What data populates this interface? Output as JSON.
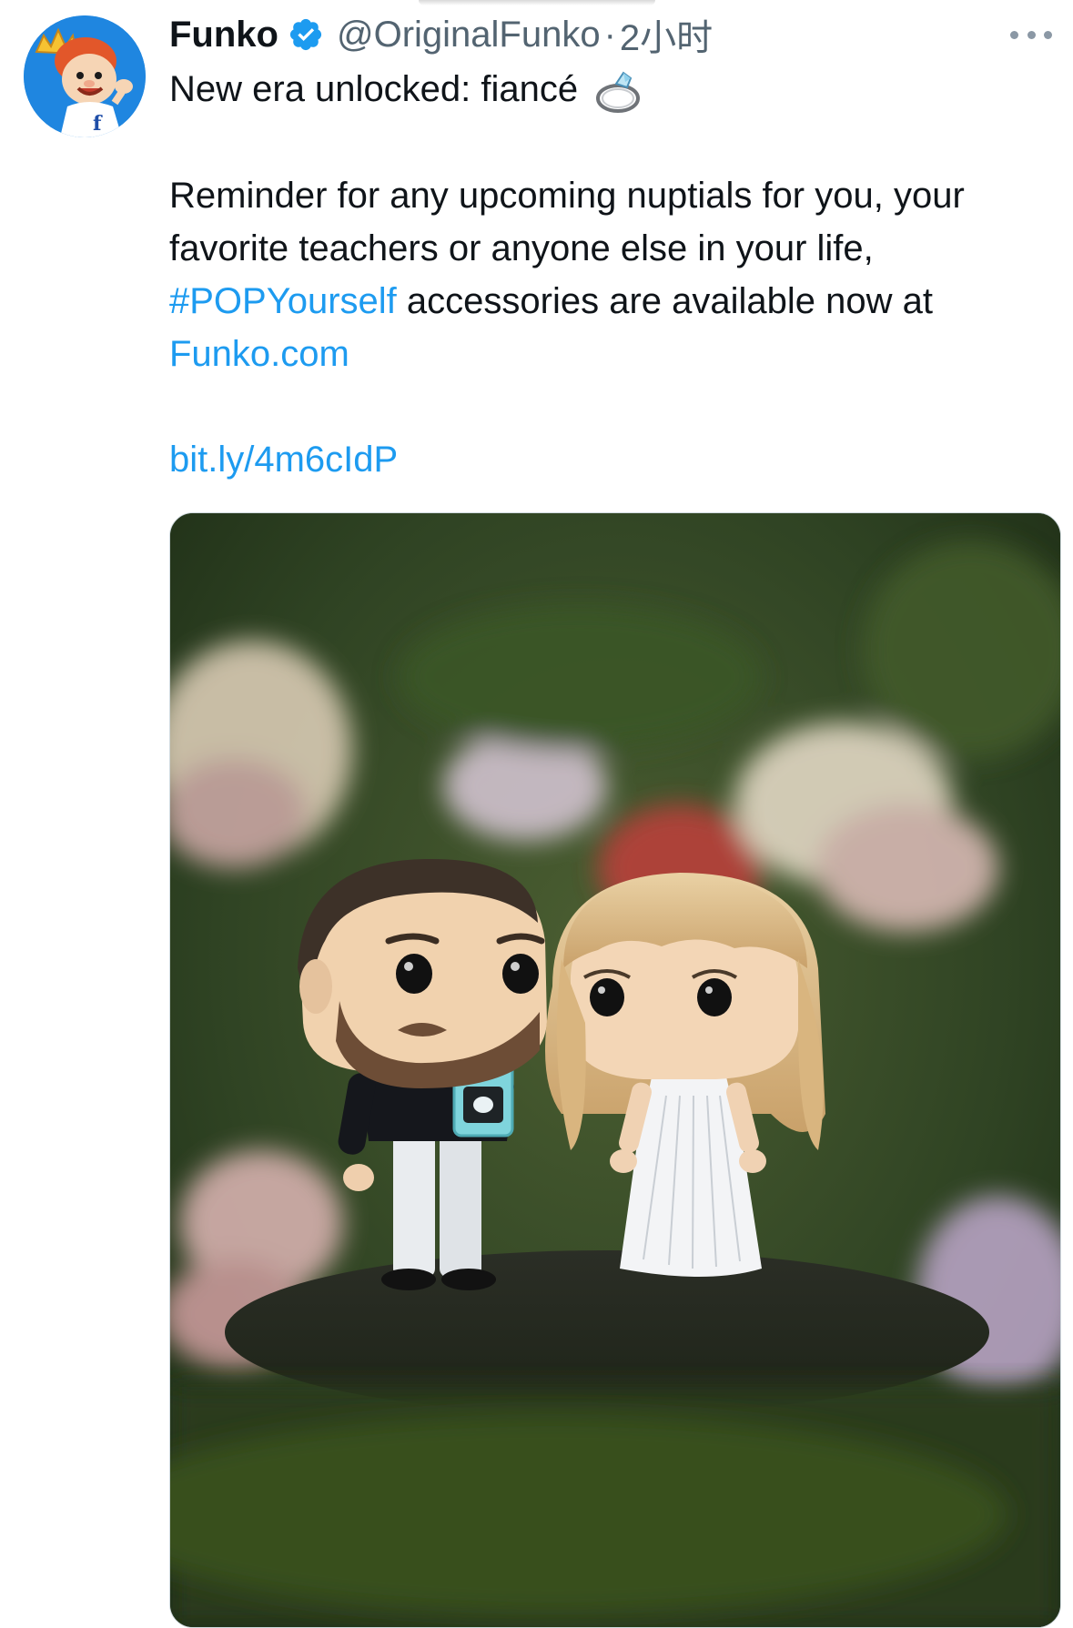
{
  "tweet": {
    "display_name": "Funko",
    "handle": "@OriginalFunko",
    "separator": "·",
    "time": "2小时",
    "line1": "New era unlocked: fiancé",
    "para_start": "Reminder for any upcoming nuptials for you, your favorite teachers or anyone else in your life, ",
    "hashtag": "#POPYourself",
    "para_mid": " accessories are available now at ",
    "site_link": "Funko.com",
    "short_url": "bit.ly/4m6cIdP"
  },
  "icons": {
    "avatar": "funko-mascot-avatar",
    "verified": "verified-badge-icon",
    "ring": "ring-emoji-icon",
    "more": "more-options-icon"
  },
  "colors": {
    "link": "#1d9bf0",
    "text": "#0f1419",
    "secondary": "#536471",
    "avatar_bg": "#1f86e0"
  }
}
